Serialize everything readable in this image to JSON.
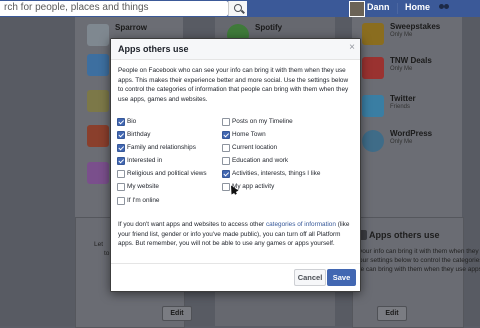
{
  "topbar": {
    "search_text": "rch for people, places and things",
    "user_name": "Dann",
    "home_label": "Home"
  },
  "background": {
    "apps": [
      {
        "name": "Sparrow",
        "privacy": ""
      },
      {
        "name": "Spotify",
        "privacy": ""
      },
      {
        "name": "Sweepstakes",
        "privacy": "Only Me"
      },
      {
        "name": "TNW Deals",
        "privacy": "Only Me"
      },
      {
        "name": "Twitter",
        "privacy": "Friends"
      },
      {
        "name": "WordPress",
        "privacy": "Only Me"
      }
    ],
    "right_card": {
      "title": "Apps others use",
      "text_lines": [
        "your info can bring it with them when they",
        "our settings below to control the categories of",
        "le can bring with them when they use apps,"
      ],
      "edit_label": "Edit"
    },
    "left_card": {
      "fragments": [
        "Let",
        "to"
      ],
      "edit_label": "Edit"
    }
  },
  "modal": {
    "title": "Apps others use",
    "close_symbol": "×",
    "intro": "People on Facebook who can see your info can bring it with them when they use apps. This makes their experience better and more social. Use the settings below to control the categories of information that people can bring with them when they use apps, games and websites.",
    "options": [
      {
        "label": "Bio",
        "checked": true
      },
      {
        "label": "Posts on my Timeline",
        "checked": false
      },
      {
        "label": "Birthday",
        "checked": true
      },
      {
        "label": "Home Town",
        "checked": true
      },
      {
        "label": "Family and relationships",
        "checked": true
      },
      {
        "label": "Current location",
        "checked": false
      },
      {
        "label": "Interested in",
        "checked": true
      },
      {
        "label": "Education and work",
        "checked": false
      },
      {
        "label": "Religious and political views",
        "checked": false
      },
      {
        "label": "Activities, interests, things I like",
        "checked": true
      },
      {
        "label": "My website",
        "checked": false
      },
      {
        "label": "My app activity",
        "checked": false
      },
      {
        "label": "If I'm online",
        "checked": false
      }
    ],
    "footer_before": "If you don't want apps and websites to access other ",
    "footer_link": "categories of information",
    "footer_after": " (like your friend list, gender or info you've made public), you can turn off all Platform apps. But remember, you will not be able to use any games or apps yourself.",
    "cancel_label": "Cancel",
    "save_label": "Save"
  },
  "colors": {
    "facebook_blue": "#3b5998",
    "button_blue": "#4267b2",
    "link_blue": "#365899"
  }
}
